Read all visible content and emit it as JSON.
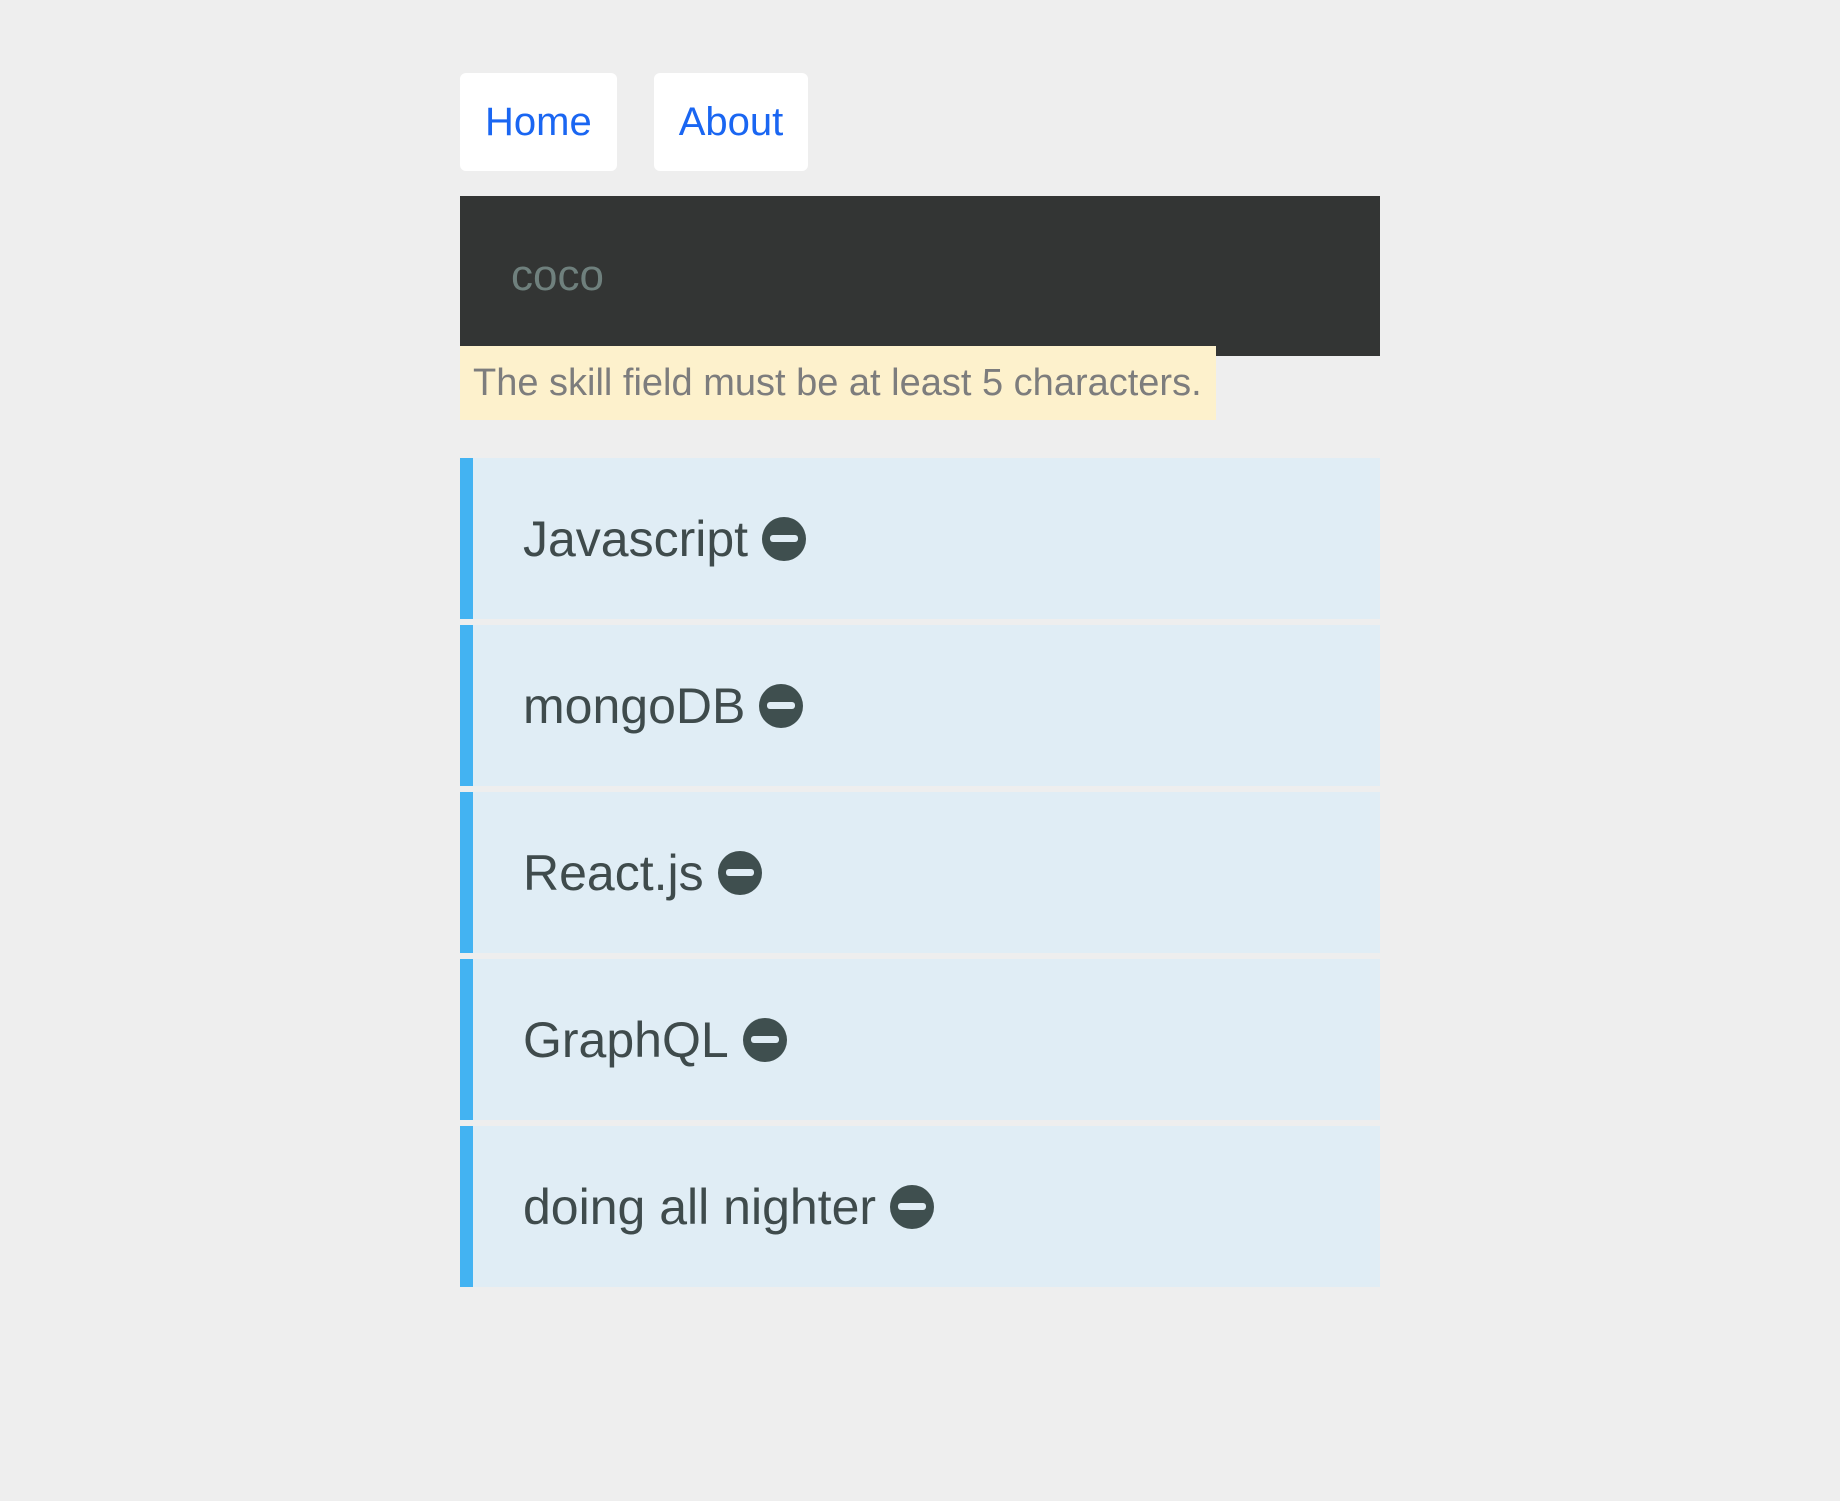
{
  "nav": {
    "home_label": "Home",
    "about_label": "About"
  },
  "skill_form": {
    "input_value": "coco",
    "error_message": "The skill field must be at least 5 characters."
  },
  "skills": [
    {
      "label": "Javascript",
      "remove_icon": "minus-circle-icon"
    },
    {
      "label": "mongoDB",
      "remove_icon": "minus-circle-icon"
    },
    {
      "label": "React.js",
      "remove_icon": "minus-circle-icon"
    },
    {
      "label": "GraphQL",
      "remove_icon": "minus-circle-icon"
    },
    {
      "label": "doing all nighter",
      "remove_icon": "minus-circle-icon"
    }
  ],
  "colors": {
    "page_background": "#eeeeee",
    "link": "#1a66f2",
    "input_background": "#333534",
    "error_background": "#fdf1cc",
    "skill_background": "#e0edf5",
    "skill_accent": "#43b3f2",
    "icon": "#3f4f4f"
  }
}
